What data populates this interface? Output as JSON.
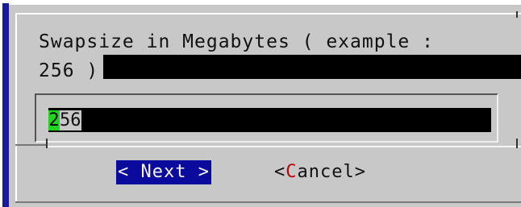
{
  "dialog": {
    "prompt_line1": "Swapsize in Megabytes ( example :",
    "prompt_line2": "256 )",
    "input_value_first": "2",
    "input_value_rest": "56"
  },
  "buttons": {
    "next_label": "< Next >",
    "cancel_prefix": "<",
    "cancel_hotkey": "C",
    "cancel_suffix": "ancel>"
  },
  "colors": {
    "dialog_background": "#c8c8c8",
    "button_focus": "#0a0a9c",
    "cursor": "#22d422",
    "hotkey": "#c00000",
    "field": "#000000"
  }
}
